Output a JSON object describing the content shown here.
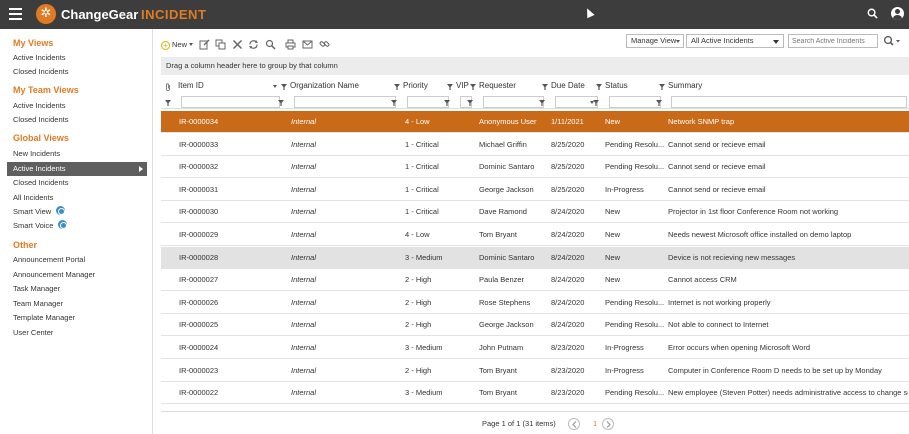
{
  "app": {
    "brand": "ChangeGear",
    "module": "INCIDENT"
  },
  "icons": {
    "menu": "hamburger-icon",
    "search": "search-icon",
    "user": "user-icon"
  },
  "colors": {
    "accent": "#e07b24",
    "topbar": "#3d3d3d",
    "selected_row": "#c96a18"
  },
  "sidebar": {
    "my_views": {
      "title": "My Views",
      "items": [
        "Active Incidents",
        "Closed Incidents"
      ]
    },
    "my_team_views": {
      "title": "My Team Views",
      "items": [
        "Active Incidents",
        "Closed Incidents"
      ]
    },
    "global_views": {
      "title": "Global Views",
      "items": [
        "New Incidents",
        "Active Incidents",
        "Closed Incidents",
        "All Incidents",
        "Smart View",
        "Smart Voice"
      ],
      "active_index": 1
    },
    "other": {
      "title": "Other",
      "items": [
        "Announcement Portal",
        "Announcement Manager",
        "Task Manager",
        "Team Manager",
        "Template Manager",
        "User Center"
      ]
    }
  },
  "toolbar": {
    "new_label": "New",
    "manage_view_label": "Manage View",
    "view_selected": "All Active Incidents",
    "search_placeholder": "Search Active Incidents"
  },
  "grid": {
    "group_hint": "Drag a column header here to group by that column",
    "columns": [
      "Item ID",
      "Organization Name",
      "Priority",
      "VIP",
      "Requester",
      "Due Date",
      "Status",
      "Summary"
    ],
    "rows": [
      {
        "id": "IR-0000034",
        "org": "Internal",
        "priority": "4 - Low",
        "requester": "Anonymous User",
        "due": "1/11/2021",
        "status": "New",
        "summary": "Network SNMP trap"
      },
      {
        "id": "IR-0000033",
        "org": "Internal",
        "priority": "1 - Critical",
        "requester": "Michael Griffin",
        "due": "8/25/2020",
        "status": "Pending Resolu...",
        "summary": "Cannot send or recieve email"
      },
      {
        "id": "IR-0000032",
        "org": "Internal",
        "priority": "1 - Critical",
        "requester": "Dominic Santaro",
        "due": "8/25/2020",
        "status": "Pending Resolu...",
        "summary": "Cannot send or recieve email"
      },
      {
        "id": "IR-0000031",
        "org": "Internal",
        "priority": "1 - Critical",
        "requester": "George Jackson",
        "due": "8/25/2020",
        "status": "In-Progress",
        "summary": "Cannot send or recieve email"
      },
      {
        "id": "IR-0000030",
        "org": "Internal",
        "priority": "1 - Critical",
        "requester": "Dave Ramond",
        "due": "8/24/2020",
        "status": "New",
        "summary": "Projector in 1st floor Conference Room not working"
      },
      {
        "id": "IR-0000029",
        "org": "Internal",
        "priority": "4 - Low",
        "requester": "Tom Bryant",
        "due": "8/24/2020",
        "status": "New",
        "summary": "Needs newest Microsoft office installed on demo laptop"
      },
      {
        "id": "IR-0000028",
        "org": "Internal",
        "priority": "3 - Medium",
        "requester": "Dominic Santaro",
        "due": "8/24/2020",
        "status": "New",
        "summary": "Device is not recieving new messages"
      },
      {
        "id": "IR-0000027",
        "org": "Internal",
        "priority": "2 - High",
        "requester": "Paula Benzer",
        "due": "8/24/2020",
        "status": "New",
        "summary": "Cannot access CRM"
      },
      {
        "id": "IR-0000026",
        "org": "Internal",
        "priority": "2 - High",
        "requester": "Rose Stephens",
        "due": "8/24/2020",
        "status": "Pending Resolu...",
        "summary": "Internet is not working properly"
      },
      {
        "id": "IR-0000025",
        "org": "Internal",
        "priority": "2 - High",
        "requester": "George Jackson",
        "due": "8/24/2020",
        "status": "Pending Resolu...",
        "summary": "Not able to connect to Internet"
      },
      {
        "id": "IR-0000024",
        "org": "Internal",
        "priority": "3 - Medium",
        "requester": "John Putnam",
        "due": "8/23/2020",
        "status": "In-Progress",
        "summary": "Error occurs when opening Microsoft Word"
      },
      {
        "id": "IR-0000023",
        "org": "Internal",
        "priority": "2 - High",
        "requester": "Tom Bryant",
        "due": "8/23/2020",
        "status": "In-Progress",
        "summary": "Computer in Conference Room D needs to be set up by Monday"
      },
      {
        "id": "IR-0000022",
        "org": "Internal",
        "priority": "3 - Medium",
        "requester": "Tom Bryant",
        "due": "8/23/2020",
        "status": "Pending Resolu...",
        "summary": "New employee (Steven Potter) needs administrative access to change settings"
      }
    ],
    "selected_index": 0,
    "hover_index": 6
  },
  "pager": {
    "summary": "Page 1 of 1 (31 items)",
    "current_page": "1"
  }
}
